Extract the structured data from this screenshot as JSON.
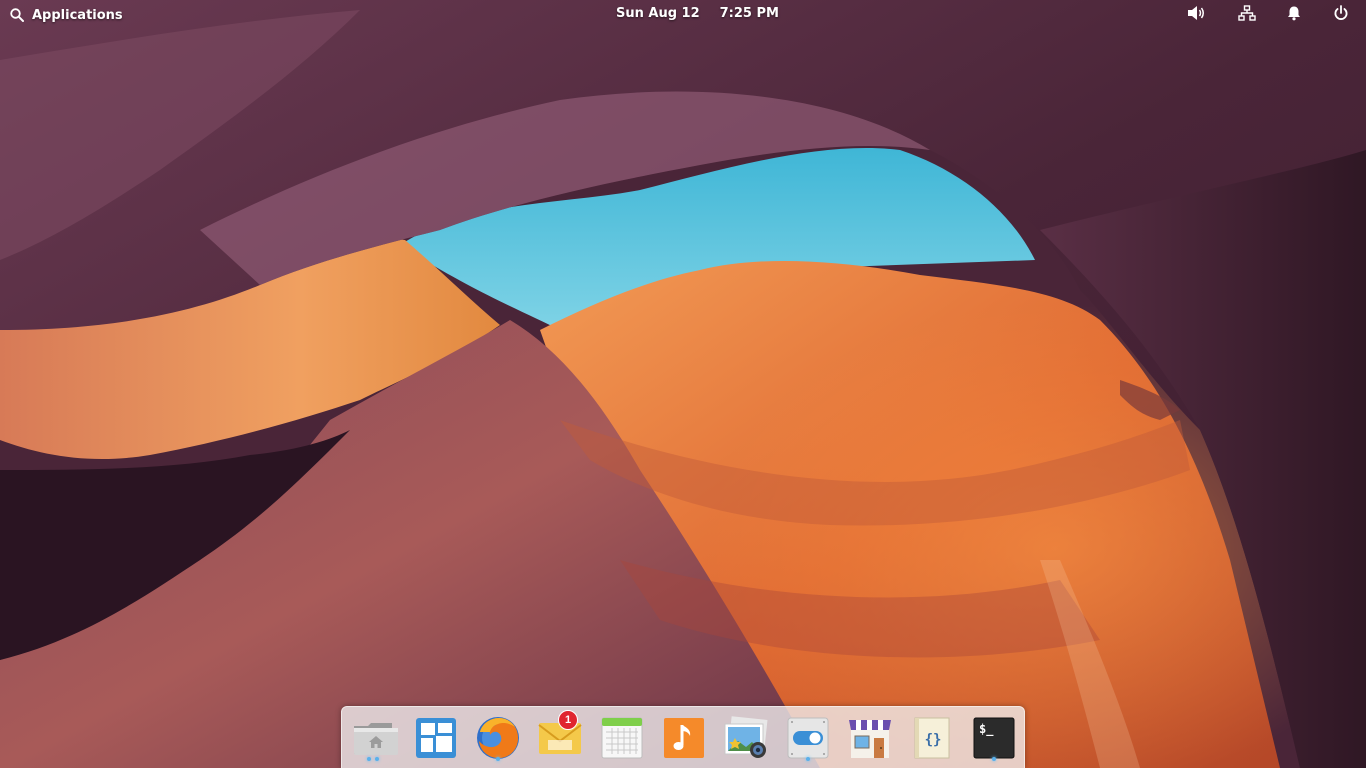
{
  "panel": {
    "applications_label": "Applications",
    "date": "Sun Aug 12",
    "time": "7:25 PM",
    "indicators": [
      "volume-icon",
      "network-icon",
      "notifications-icon",
      "power-icon"
    ]
  },
  "dock": {
    "items": [
      {
        "icon": "files-icon",
        "running": true
      },
      {
        "icon": "multitasking-view-icon",
        "running": false
      },
      {
        "icon": "firefox-icon",
        "running": true
      },
      {
        "icon": "mail-icon",
        "running": false,
        "badge": "1"
      },
      {
        "icon": "calendar-icon",
        "running": false
      },
      {
        "icon": "music-icon",
        "running": false
      },
      {
        "icon": "photos-icon",
        "running": false
      },
      {
        "icon": "system-settings-icon",
        "running": true
      },
      {
        "icon": "appcenter-icon",
        "running": false
      },
      {
        "icon": "code-icon",
        "running": false
      },
      {
        "icon": "terminal-icon",
        "running": true
      }
    ]
  },
  "colors": {
    "sky": "#4fc2dc",
    "rock_purple": "#5b2f45",
    "rock_orange": "#e57a3d",
    "running_indicator": "#5bb0ea",
    "badge": "#e0252f"
  }
}
